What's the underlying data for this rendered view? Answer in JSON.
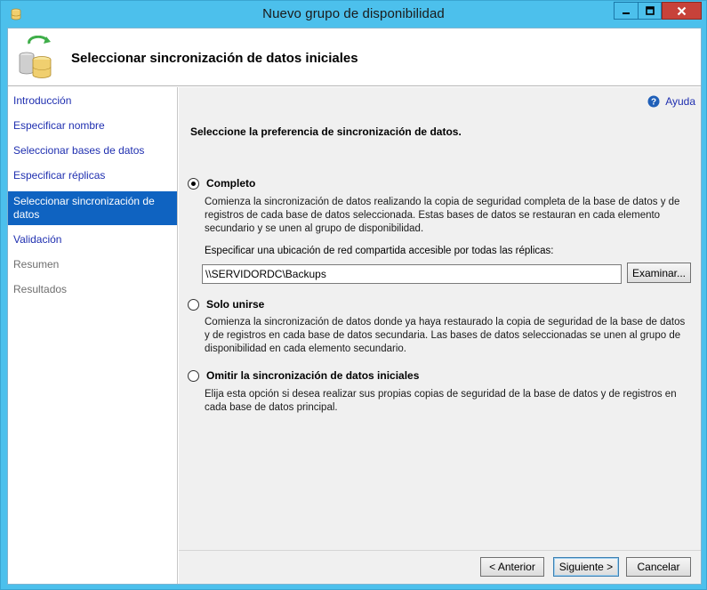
{
  "window": {
    "title": "Nuevo grupo de disponibilidad"
  },
  "header": {
    "title": "Seleccionar sincronización de datos iniciales"
  },
  "nav": {
    "items": [
      {
        "label": "Introducción",
        "state": "link"
      },
      {
        "label": "Especificar nombre",
        "state": "link"
      },
      {
        "label": "Seleccionar bases de datos",
        "state": "link"
      },
      {
        "label": "Especificar réplicas",
        "state": "link"
      },
      {
        "label": "Seleccionar sincronización de datos",
        "state": "active"
      },
      {
        "label": "Validación",
        "state": "link"
      },
      {
        "label": "Resumen",
        "state": "disabled"
      },
      {
        "label": "Resultados",
        "state": "disabled"
      }
    ]
  },
  "help": {
    "label": "Ayuda"
  },
  "main": {
    "prompt": "Seleccione la preferencia de sincronización de datos.",
    "options": [
      {
        "label": "Completo",
        "checked": true,
        "description": "Comienza la sincronización de datos realizando la copia de seguridad completa de la base de datos y de registros de cada base de datos seleccionada. Estas bases de datos se restauran en cada elemento secundario y se unen al grupo de disponibilidad."
      },
      {
        "label": "Solo unirse",
        "checked": false,
        "description": "Comienza la sincronización de datos donde ya haya restaurado la copia de seguridad de la base de datos y de registros en cada base de datos secundaria. Las bases de datos seleccionadas se unen al grupo de disponibilidad en cada elemento secundario."
      },
      {
        "label": "Omitir la sincronización de datos iniciales",
        "checked": false,
        "description": "Elija esta opción si desea realizar sus propias copias de seguridad de la base de datos y de registros en cada base de datos principal."
      }
    ],
    "share_label": "Especificar una ubicación de red compartida accesible por todas las réplicas:",
    "share_value": "\\\\SERVIDORDC\\Backups",
    "browse_label": "Examinar..."
  },
  "footer": {
    "back_label": "< Anterior",
    "next_label": "Siguiente >",
    "cancel_label": "Cancelar"
  },
  "colors": {
    "titlebar": "#4cc0ec",
    "close": "#c7423a",
    "nav_active": "#0f63c1",
    "link": "#1f2fb0"
  }
}
